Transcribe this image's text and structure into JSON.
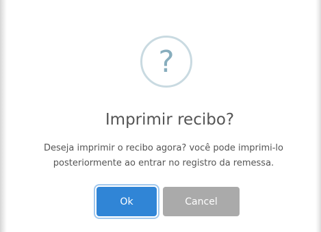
{
  "dialog": {
    "icon": "question-icon",
    "icon_glyph": "?",
    "title": "Imprimir recibo?",
    "message_line1": "Deseja imprimir o recibo agora? você pode imprimi-lo",
    "message_line2": "posteriormente ao entrar no registro da remessa.",
    "confirm_label": "Ok",
    "cancel_label": "Cancel"
  },
  "colors": {
    "confirm": "#3085d6",
    "cancel": "#aaaaaa",
    "icon_border": "#c9dae1",
    "icon_glyph": "#87adbd",
    "text": "#545454"
  }
}
